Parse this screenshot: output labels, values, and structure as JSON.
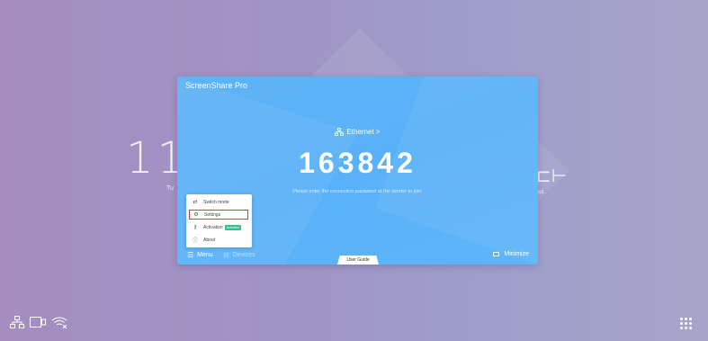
{
  "background": {
    "clock_text": "11",
    "clock_subtext": "Tu",
    "input_label": "put"
  },
  "app": {
    "title": "ScreenShare Pro",
    "network_label": "Ethernet >",
    "network_icon": "ethernet-icon",
    "code": "163842",
    "hint": "Please enter the connection password at the sender to join.",
    "accent_color": "#59b1f9"
  },
  "menu_popup": {
    "items": [
      {
        "label": "Switch mode",
        "icon": "switch-icon"
      },
      {
        "label": "Settings",
        "icon": "settings-icon",
        "selected": true
      },
      {
        "label": "Activation",
        "icon": "key-icon",
        "badge": "Activated"
      },
      {
        "label": "About",
        "icon": "info-icon"
      }
    ]
  },
  "bottom_bar": {
    "menu_label": "Menu",
    "devices_label": "Devices",
    "guide_label": "User Guide",
    "minimize_label": "Minimize"
  },
  "taskbar": {
    "left_icons": [
      "network-icon",
      "screen-cast-icon",
      "wifi-off-icon"
    ],
    "right_icon": "apps-grid-icon"
  }
}
